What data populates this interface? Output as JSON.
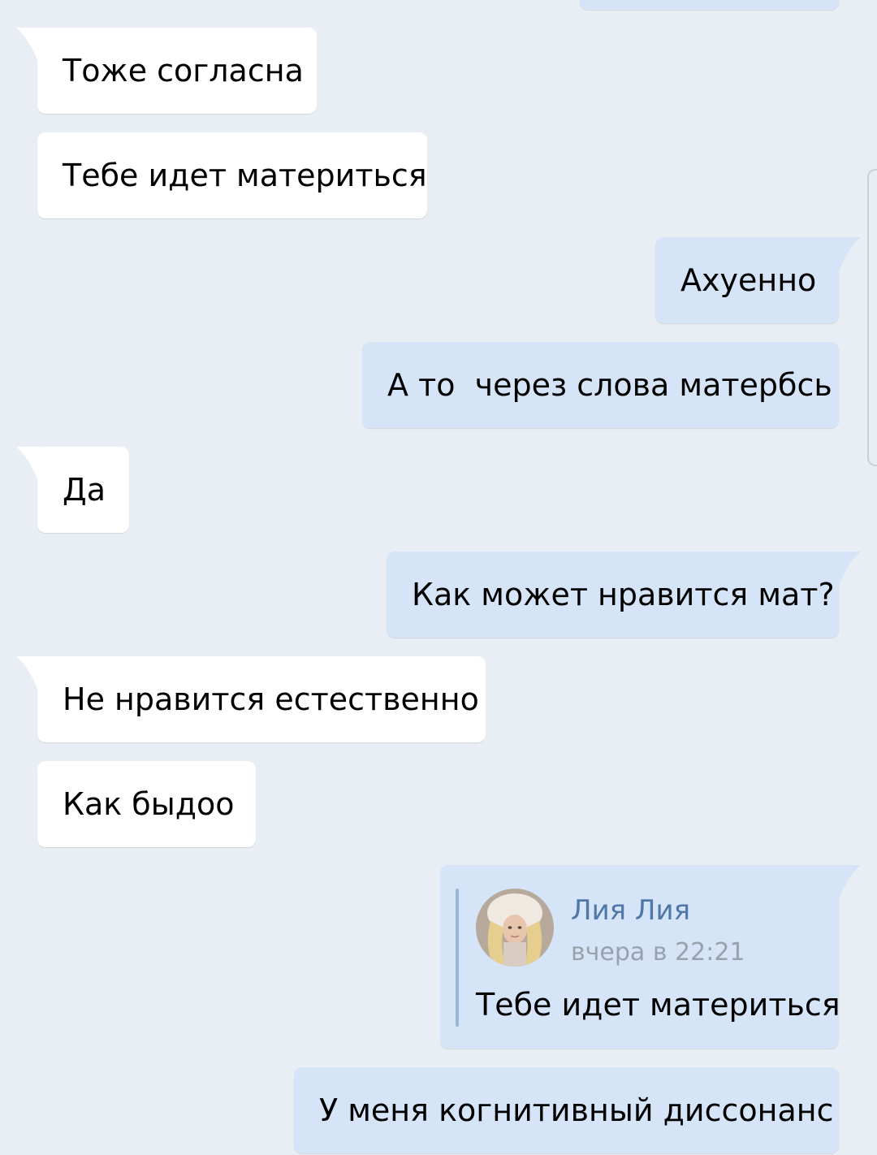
{
  "colors": {
    "background": "#e9eef4",
    "incoming_bubble": "#ffffff",
    "outgoing_bubble": "#d5e4f7",
    "sender_name": "#4f77a8",
    "timestamp": "#98a2ad"
  },
  "messages": [
    {
      "direction": "in",
      "text": "Тоже согласна"
    },
    {
      "direction": "in",
      "text": "Тебе идет материться"
    },
    {
      "direction": "out",
      "text": "Ахуенно"
    },
    {
      "direction": "out",
      "text": "А то  через слова матербсь"
    },
    {
      "direction": "in",
      "text": "Да"
    },
    {
      "direction": "out",
      "text": "Как может нравится мат?"
    },
    {
      "direction": "in",
      "text": "Не нравится естественно"
    },
    {
      "direction": "in",
      "text": "Как быдоо"
    }
  ],
  "forwarded": {
    "sender_name": "Лия Лия",
    "timestamp": "вчера в 22:21",
    "text": "Тебе идет материться",
    "avatar_icon": "user-avatar-photo"
  },
  "last_message": {
    "direction": "out",
    "text": "У меня когнитивный диссонанс"
  }
}
